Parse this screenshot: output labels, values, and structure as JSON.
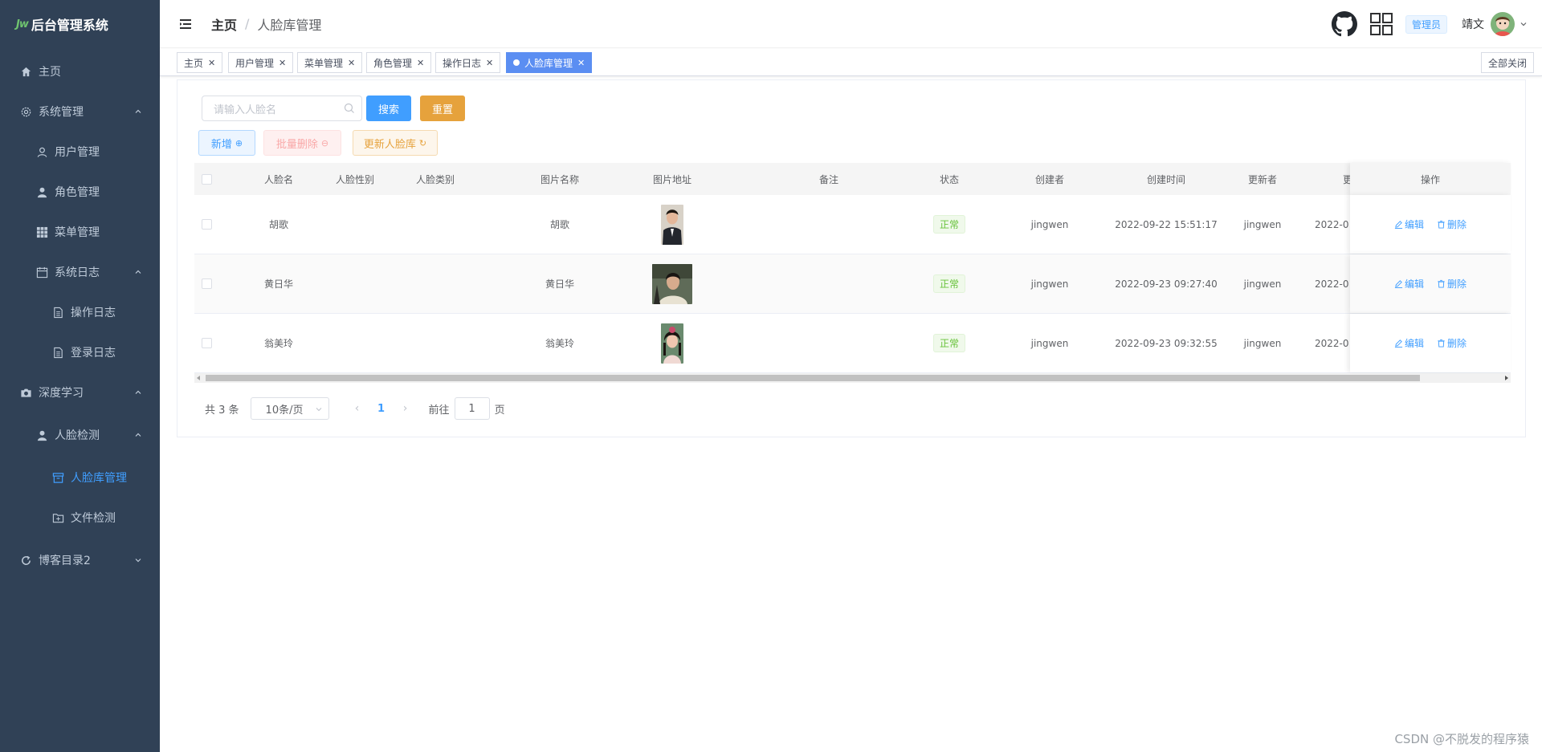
{
  "sidebar": {
    "logo_mark": "Jw",
    "title": "后台管理系统",
    "items": [
      {
        "label": "主页"
      },
      {
        "label": "系统管理"
      },
      {
        "label": "用户管理"
      },
      {
        "label": "角色管理"
      },
      {
        "label": "菜单管理"
      },
      {
        "label": "系统日志"
      },
      {
        "label": "操作日志"
      },
      {
        "label": "登录日志"
      },
      {
        "label": "深度学习"
      },
      {
        "label": "人脸检测"
      },
      {
        "label": "人脸库管理"
      },
      {
        "label": "文件检测"
      },
      {
        "label": "博客目录2"
      }
    ]
  },
  "navbar": {
    "breadcrumb_home": "主页",
    "breadcrumb_sep": "/",
    "breadcrumb_current": "人脸库管理",
    "role": "管理员",
    "username": "靖文"
  },
  "tags": {
    "items": [
      {
        "label": "主页"
      },
      {
        "label": "用户管理"
      },
      {
        "label": "菜单管理"
      },
      {
        "label": "角色管理"
      },
      {
        "label": "操作日志"
      },
      {
        "label": "人脸库管理"
      }
    ],
    "close_all": "全部关闭"
  },
  "toolbar": {
    "search_placeholder": "请输入人脸名",
    "search_label": "搜索",
    "reset_label": "重置",
    "add_label": "新增",
    "batch_delete_label": "批量删除",
    "update_label": "更新人脸库"
  },
  "table": {
    "headers": {
      "name": "人脸名",
      "gender": "人脸性别",
      "category": "人脸类别",
      "image_name": "图片名称",
      "image_url": "图片地址",
      "remark": "备注",
      "status": "状态",
      "creator": "创建者",
      "created_at": "创建时间",
      "updater": "更新者",
      "updated_at_partial": "更",
      "actions": "操作"
    },
    "rows": [
      {
        "name": "胡歌",
        "image_name": "胡歌",
        "status": "正常",
        "creator": "jingwen",
        "created_at": "2022-09-22 15:51:17",
        "updater": "jingwen",
        "updated_at": "2022-0",
        "edit": "编辑",
        "delete": "删除"
      },
      {
        "name": "黄日华",
        "image_name": "黄日华",
        "status": "正常",
        "creator": "jingwen",
        "created_at": "2022-09-23 09:27:40",
        "updater": "jingwen",
        "updated_at": "2022-0",
        "edit": "编辑",
        "delete": "删除"
      },
      {
        "name": "翁美玲",
        "image_name": "翁美玲",
        "status": "正常",
        "creator": "jingwen",
        "created_at": "2022-09-23 09:32:55",
        "updater": "jingwen",
        "updated_at": "2022-0",
        "edit": "编辑",
        "delete": "删除"
      }
    ]
  },
  "pagination": {
    "total_text": "共 3 条",
    "page_size": "10条/页",
    "current_page": "1",
    "goto_prefix": "前往",
    "goto_value": "1",
    "goto_suffix": "页"
  },
  "watermark": "CSDN @不脱发的程序猿",
  "colors": {
    "sidebar_bg": "#304156",
    "primary": "#409eff",
    "warning": "#e6a23c",
    "success": "#67c23a",
    "active_tag": "#5b8ef2"
  }
}
